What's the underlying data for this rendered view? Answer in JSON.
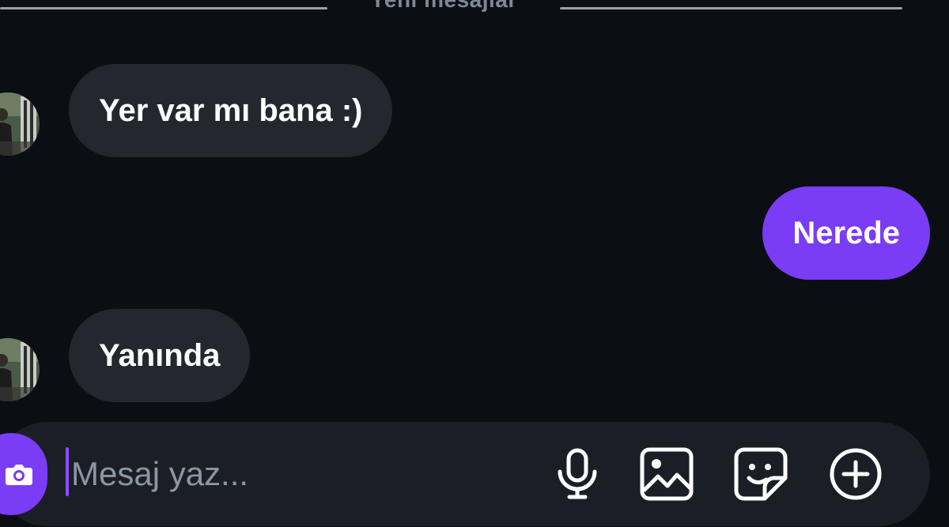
{
  "chat": {
    "divider_label": "Yeni mesajlar",
    "messages": [
      {
        "direction": "incoming",
        "text": "Yer var mı bana :)"
      },
      {
        "direction": "outgoing",
        "text": "Nerede"
      },
      {
        "direction": "incoming",
        "text": "Yanında"
      }
    ]
  },
  "composer": {
    "placeholder": "Mesaj yaz...",
    "value": "",
    "icons": [
      "camera-icon",
      "microphone-icon",
      "image-icon",
      "sticker-icon",
      "plus-circle-icon"
    ]
  },
  "colors": {
    "background": "#0b0e13",
    "incoming_bubble": "#24282e",
    "outgoing_bubble": "#7a3cf5",
    "composer": "#1b1f25",
    "accent": "#7a3cf5"
  }
}
